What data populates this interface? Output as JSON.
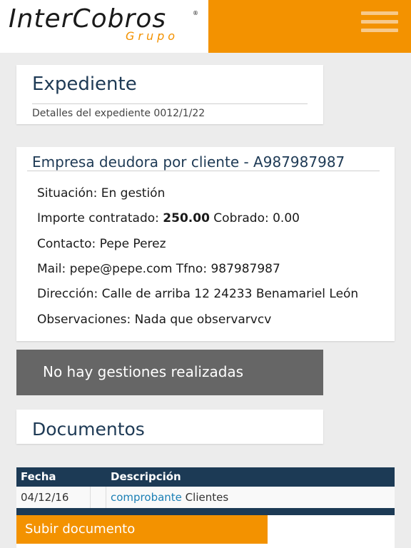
{
  "header": {
    "logo_main": "InterCobros",
    "logo_reg": "®",
    "logo_sub": "Grupo",
    "menu_icon": "hamburger-menu-icon",
    "colors": {
      "brand_orange": "#f39200",
      "navy": "#1c3a55"
    }
  },
  "expediente": {
    "title": "Expediente",
    "subtitle": "Detalles del expediente 0012/1/22"
  },
  "empresa": {
    "title": "Empresa deudora por cliente - A987987987",
    "situacion": "Situación: En gestión",
    "importe_label": "Importe contratado: ",
    "importe_value": "250.00",
    "cobrado": " Cobrado: 0.00",
    "contacto": "Contacto: Pepe Perez",
    "mail": "Mail: pepe@pepe.com Tfno: 987987987",
    "direccion": "Dirección: Calle de arriba 12 24233 Benamariel León",
    "observaciones": "Observaciones: Nada que observarvcv"
  },
  "gestiones": {
    "empty_text": "No hay gestiones realizadas"
  },
  "documentos": {
    "title": "Documentos",
    "columns": [
      "Fecha",
      "Descripción"
    ],
    "rows": [
      {
        "fecha": "04/12/16",
        "link": "comprobante",
        "desc": " Clientes"
      }
    ],
    "upload_label": "Subir documento"
  }
}
